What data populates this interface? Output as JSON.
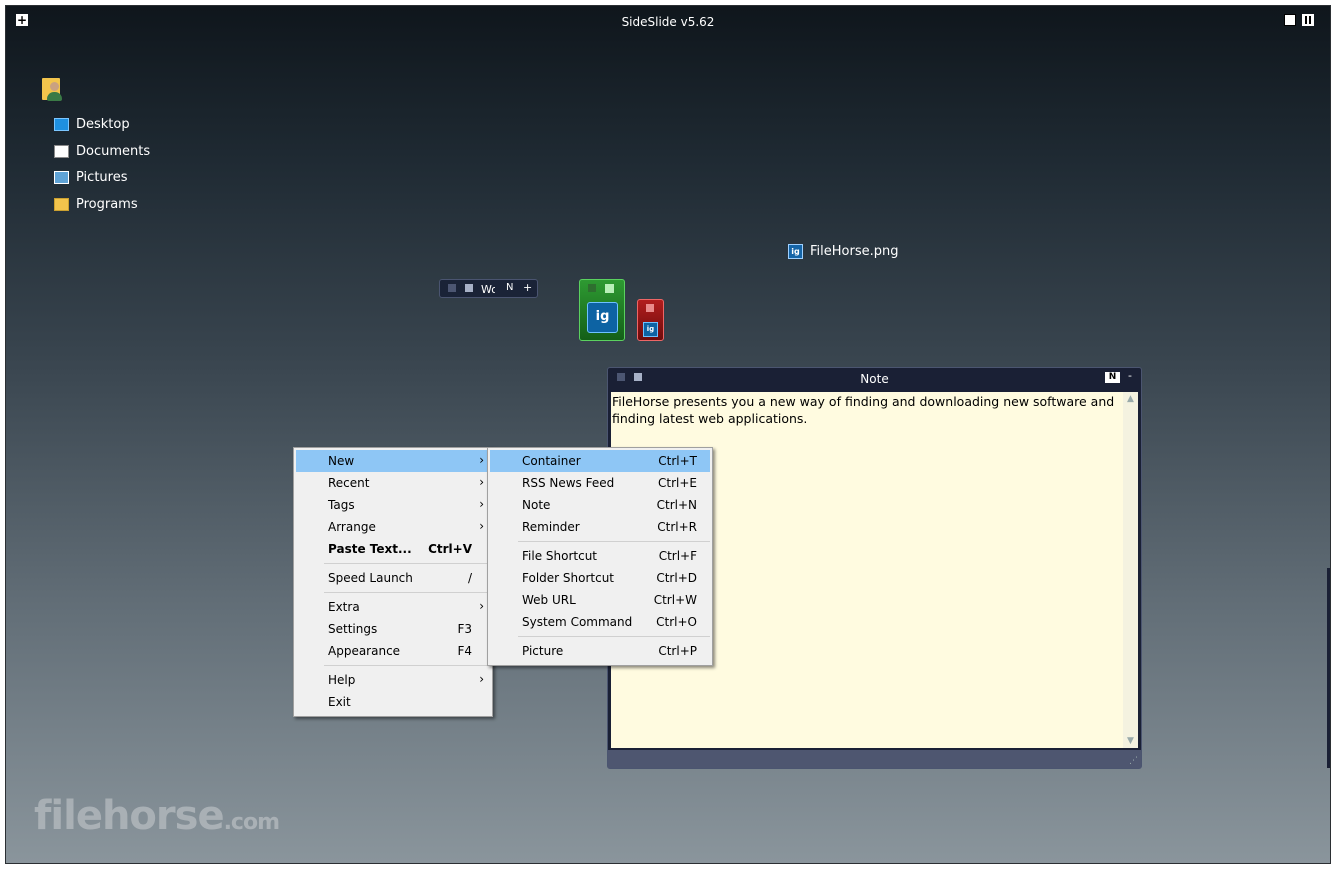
{
  "app": {
    "title": "SideSlide v5.62"
  },
  "places": [
    {
      "label": "Desktop",
      "icon": "desktop-icon"
    },
    {
      "label": "Documents",
      "icon": "documents-icon"
    },
    {
      "label": "Pictures",
      "icon": "pictures-icon"
    },
    {
      "label": "Programs",
      "icon": "programs-folder-icon"
    }
  ],
  "file_item": {
    "label": "FileHorse.png",
    "icon": "image-file-icon"
  },
  "mini_container": {
    "title": "Wo",
    "n_label": "N",
    "plus": "+"
  },
  "note": {
    "title": "Note",
    "n_label": "N",
    "dash": "-",
    "text": "FileHorse presents you a new way of finding and downloading new software and finding latest web applications."
  },
  "context_menu": {
    "items": [
      {
        "label": "New",
        "shortcut": "",
        "submenu": true,
        "highlight": true
      },
      {
        "label": "Recent",
        "shortcut": "",
        "submenu": true
      },
      {
        "label": "Tags",
        "shortcut": "",
        "submenu": true
      },
      {
        "label": "Arrange",
        "shortcut": "",
        "submenu": true
      },
      {
        "label": "Paste Text...",
        "shortcut": "Ctrl+V",
        "bold": true
      },
      {
        "label": "Speed Launch",
        "shortcut": "/"
      },
      {
        "label": "Extra",
        "shortcut": "",
        "submenu": true
      },
      {
        "label": "Settings",
        "shortcut": "F3"
      },
      {
        "label": "Appearance",
        "shortcut": "F4"
      },
      {
        "label": "Help",
        "shortcut": "",
        "submenu": true
      },
      {
        "label": "Exit",
        "shortcut": ""
      }
    ]
  },
  "new_submenu": {
    "items": [
      {
        "label": "Container",
        "shortcut": "Ctrl+T",
        "highlight": true
      },
      {
        "label": "RSS News Feed",
        "shortcut": "Ctrl+E"
      },
      {
        "label": "Note",
        "shortcut": "Ctrl+N"
      },
      {
        "label": "Reminder",
        "shortcut": "Ctrl+R"
      },
      {
        "label": "File Shortcut",
        "shortcut": "Ctrl+F"
      },
      {
        "label": "Folder Shortcut",
        "shortcut": "Ctrl+D"
      },
      {
        "label": "Web URL",
        "shortcut": "Ctrl+W"
      },
      {
        "label": "System Command",
        "shortcut": "Ctrl+O"
      },
      {
        "label": "Picture",
        "shortcut": "Ctrl+P"
      }
    ]
  },
  "watermark": {
    "main": "filehorse",
    "suffix": ".com"
  },
  "colors": {
    "menu_highlight": "#8ec6f5",
    "note_bg": "#fffbe0",
    "green_container": "#2e9a32",
    "red_container": "#b21d1d"
  }
}
